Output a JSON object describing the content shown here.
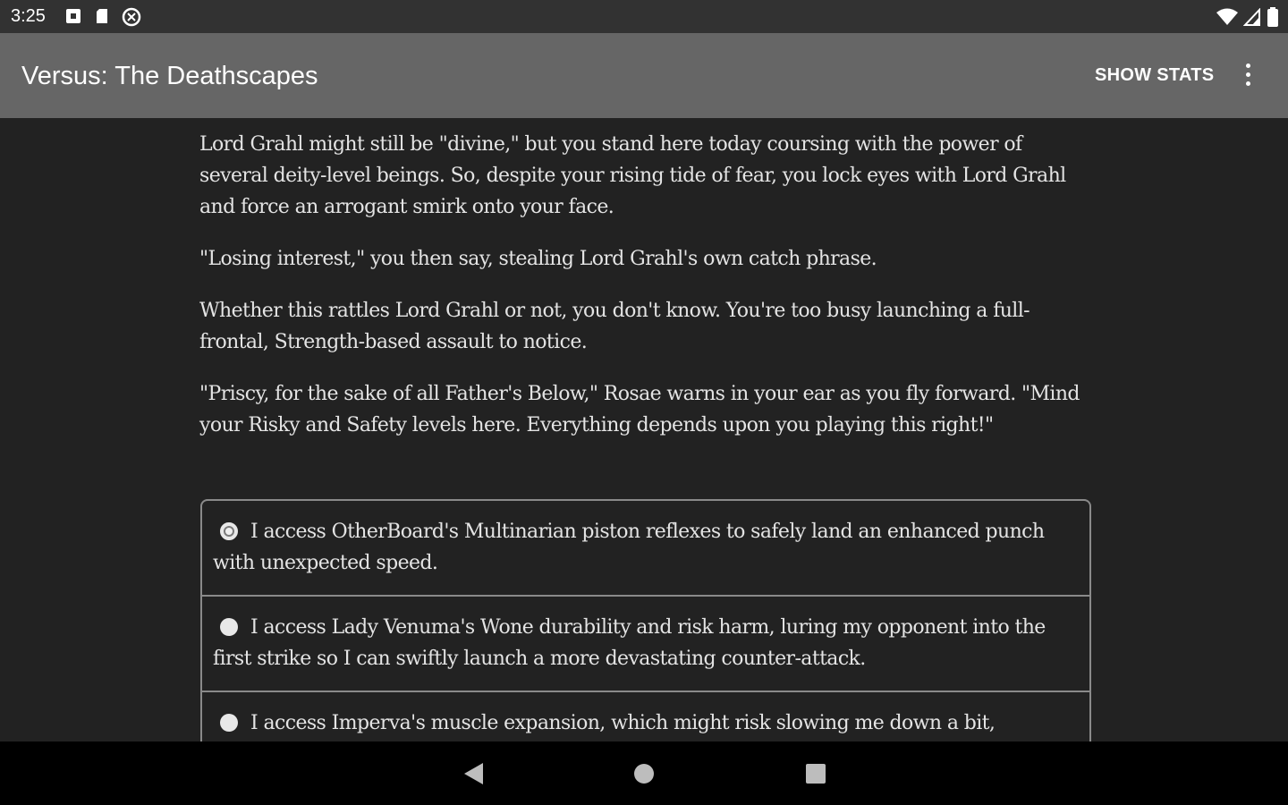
{
  "status_bar": {
    "time": "3:25",
    "icons_left": [
      "notification-square-icon",
      "sd-card-icon",
      "at-sign-icon"
    ],
    "icons_right": [
      "wifi-icon",
      "cell-signal-icon",
      "battery-icon"
    ]
  },
  "app_bar": {
    "title": "Versus: The Deathscapes",
    "show_stats_label": "SHOW STATS",
    "menu_icon": "more-vert-icon"
  },
  "story": {
    "paragraphs": [
      "Lord Grahl might still be \"divine,\" but you stand here today coursing with the power of several deity-level beings. So, despite your rising tide of fear, you lock eyes with Lord Grahl and force an arrogant smirk onto your face.",
      "\"Losing interest,\" you then say, stealing Lord Grahl's own catch phrase.",
      "Whether this rattles Lord Grahl or not, you don't know. You're too busy launching a full-frontal, Strength-based assault to notice.",
      "\"Priscy, for the sake of all Father's Below,\" Rosae warns in your ear as you fly forward. \"Mind your Risky and Safety levels here. Everything depends upon you playing this right!\""
    ]
  },
  "choices": [
    {
      "text": "I access OtherBoard's Multinarian piston reflexes to safely land an enhanced punch with unexpected speed.",
      "selected": true
    },
    {
      "text": "I access Lady Venuma's Wone durability and risk harm, luring my opponent into the first strike so I can swiftly launch a more devastating counter-attack.",
      "selected": false
    },
    {
      "text": "I access Imperva's muscle expansion, which might risk slowing me down a bit,",
      "selected": false
    }
  ],
  "nav_bar": {
    "back_icon": "back-triangle-icon",
    "home_icon": "home-circle-icon",
    "recents_icon": "recents-square-icon"
  }
}
